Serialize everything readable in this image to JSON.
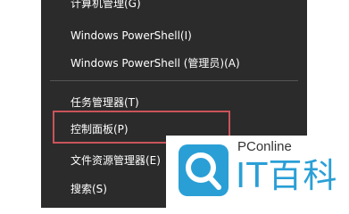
{
  "menu": {
    "items": [
      {
        "label": "计算机管理(G)"
      },
      {
        "label": "Windows PowerShell(I)"
      },
      {
        "label": "Windows PowerShell (管理员)(A)"
      },
      {
        "label": "任务管理器(T)"
      },
      {
        "label": "控制面板(P)"
      },
      {
        "label": "文件资源管理器(E)"
      },
      {
        "label": "搜索(S)"
      }
    ]
  },
  "watermark": {
    "brand": "PConline",
    "name": "IT百科"
  },
  "colors": {
    "menu_background": "#2b2b2b",
    "menu_text": "#ffffff",
    "highlight_border": "#c9545a",
    "logo_blue": "#2a9fd6"
  }
}
